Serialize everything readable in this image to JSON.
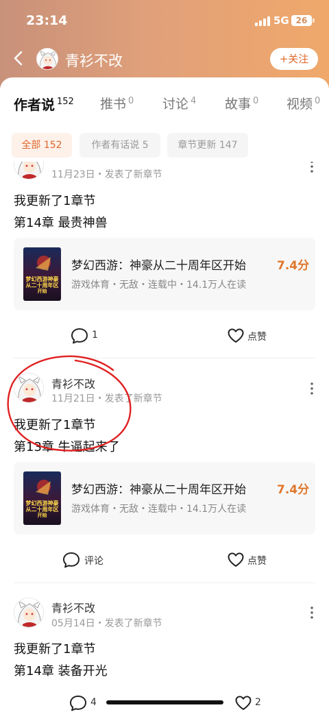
{
  "status": {
    "time": "23:14",
    "network": "5G",
    "battery": "26"
  },
  "nav": {
    "title": "青衫不改",
    "follow_label": "+关注"
  },
  "tabs": [
    {
      "label": "作者说",
      "count": "152"
    },
    {
      "label": "推书",
      "count": "0"
    },
    {
      "label": "讨论",
      "count": "4"
    },
    {
      "label": "故事",
      "count": "0"
    },
    {
      "label": "视频",
      "count": "0"
    }
  ],
  "chips": [
    {
      "label": "全部 152"
    },
    {
      "label": "作者有话说 5"
    },
    {
      "label": "章节更新 147"
    }
  ],
  "posts": [
    {
      "name": "",
      "meta": "11月23日・发表了新章节",
      "line1": "我更新了1章节",
      "line2": "第14章 最贵神兽",
      "book": {
        "title": "梦幻西游：神豪从二十周年区开始",
        "info": "游戏体育・无敌・连载中・14.1万人在读",
        "score": "7.4分"
      },
      "comment": "1",
      "like": "点赞"
    },
    {
      "name": "青衫不改",
      "meta": "11月21日・发表了新章节",
      "line1": "我更新了1章节",
      "line2": "第13章 牛逼起来了",
      "book": {
        "title": "梦幻西游：神豪从二十周年区开始",
        "info": "游戏体育・无敌・连载中・14.1万人在读",
        "score": "7.4分"
      },
      "comment": "评论",
      "like": "点赞"
    },
    {
      "name": "青衫不改",
      "meta": "05月14日・发表了新章节",
      "line1": "我更新了1章节",
      "line2": "第14章 装备开光",
      "comment": "4",
      "like": "2"
    }
  ],
  "cover_text": {
    "line1": "梦幻西游神豪",
    "line2": "从二十周年区",
    "line3": "开始"
  },
  "colors": {
    "accent": "#e0672b",
    "score": "#e0772b",
    "header_start": "#c8917a",
    "header_end": "#f0a86a",
    "annotation": "#e02020"
  }
}
